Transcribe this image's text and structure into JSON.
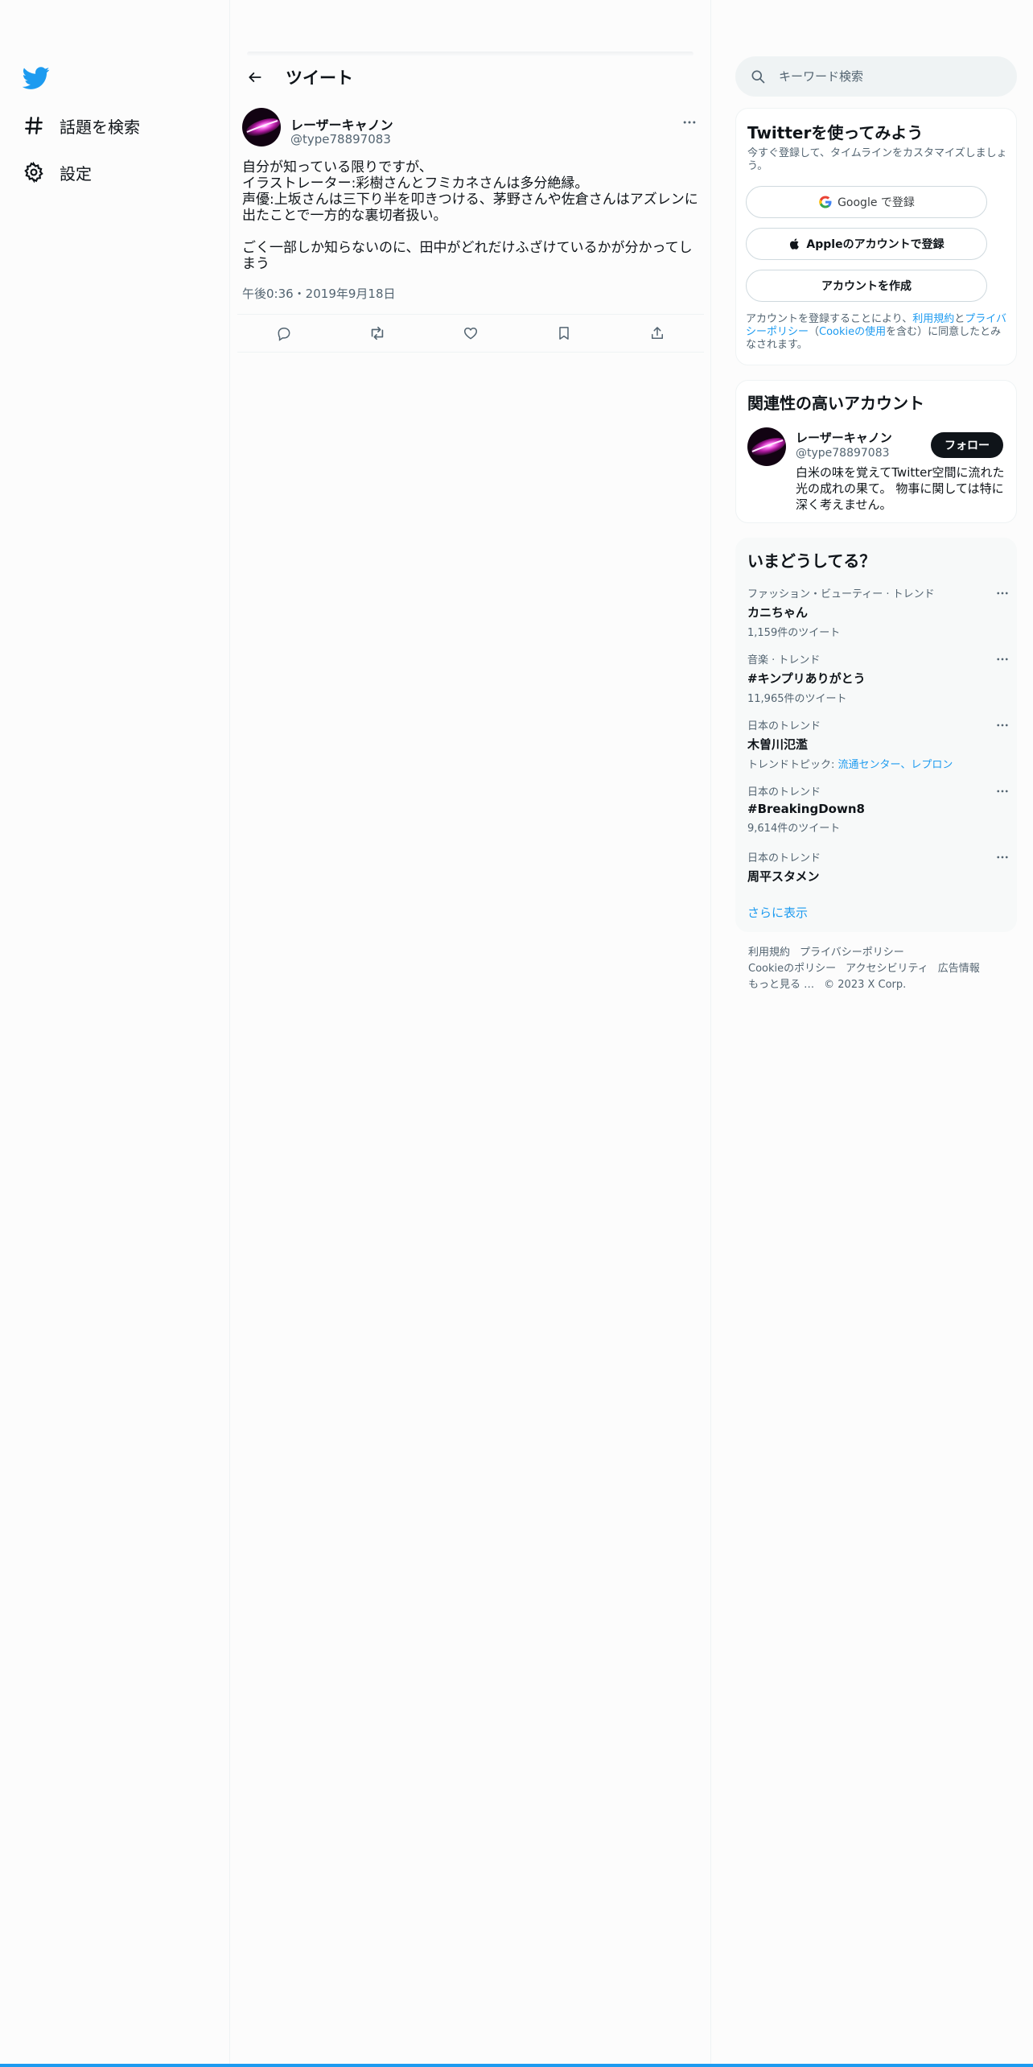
{
  "nav": {
    "items": [
      {
        "label": "話題を検索",
        "icon": "hashtag-icon"
      },
      {
        "label": "設定",
        "icon": "gear-icon"
      }
    ]
  },
  "header": {
    "title": "ツイート"
  },
  "tweet": {
    "author_name": "レーザーキャノン",
    "author_handle": "@type78897083",
    "text": "自分が知っている限りですが、\nイラストレーター:彩樹さんとフミカネさんは多分絶縁。\n声優:上坂さんは三下り半を叩きつける、茅野さんや佐倉さんはアズレンに出たことで一方的な裏切者扱い。\n\nごく一部しか知らないのに、田中がどれだけふざけているかが分かってしまう",
    "time": "午後0:36・2019年9月18日"
  },
  "search": {
    "placeholder": "キーワード検索"
  },
  "signup": {
    "title": "Twitterを使ってみよう",
    "subtitle": "今すぐ登録して、タイムラインをカスタマイズしましょう。",
    "google_label": "Google で登録",
    "apple_label": "Appleのアカウントで登録",
    "create_label": "アカウントを作成",
    "terms_prefix": "アカウントを登録することにより、",
    "terms_link": "利用規約",
    "terms_and": "と",
    "privacy_link": "プライバシーポリシー",
    "terms_paren_open": "（",
    "cookie_link": "Cookieの使用",
    "terms_suffix": "を含む）に同意したとみなされます。"
  },
  "related": {
    "title": "関連性の高いアカウント",
    "name": "レーザーキャノン",
    "handle": "@type78897083",
    "bio": "白米の味を覚えてTwitter空間に流れた光の成れの果て。 物事に関しては特に深く考えません。",
    "follow_label": "フォロー"
  },
  "trends": {
    "title": "いまどうしてる？",
    "items": [
      {
        "category": "ファッション・ビューティー · トレンド",
        "name": "カニちゃん",
        "count": "1,159件のツイート"
      },
      {
        "category": "音楽 · トレンド",
        "name": "#キンプリありがとう",
        "count": "11,965件のツイート"
      },
      {
        "category": "日本のトレンド",
        "name": "木曽川氾濫",
        "topic_prefix": "トレンドトピック: ",
        "topic_links": "流通センター、レプロン"
      },
      {
        "category": "日本のトレンド",
        "name": "#BreakingDown8",
        "count": "9,614件のツイート"
      },
      {
        "category": "日本のトレンド",
        "name": "周平スタメン"
      }
    ],
    "show_more": "さらに表示"
  },
  "footer": {
    "links": [
      "利用規約",
      "プライバシーポリシー",
      "Cookieのポリシー",
      "アクセシビリティ",
      "広告情報",
      "もっと見る …",
      "© 2023 X Corp."
    ]
  },
  "colors": {
    "accent": "#1d9bf0",
    "text": "#0f1419",
    "muted": "#536471"
  }
}
